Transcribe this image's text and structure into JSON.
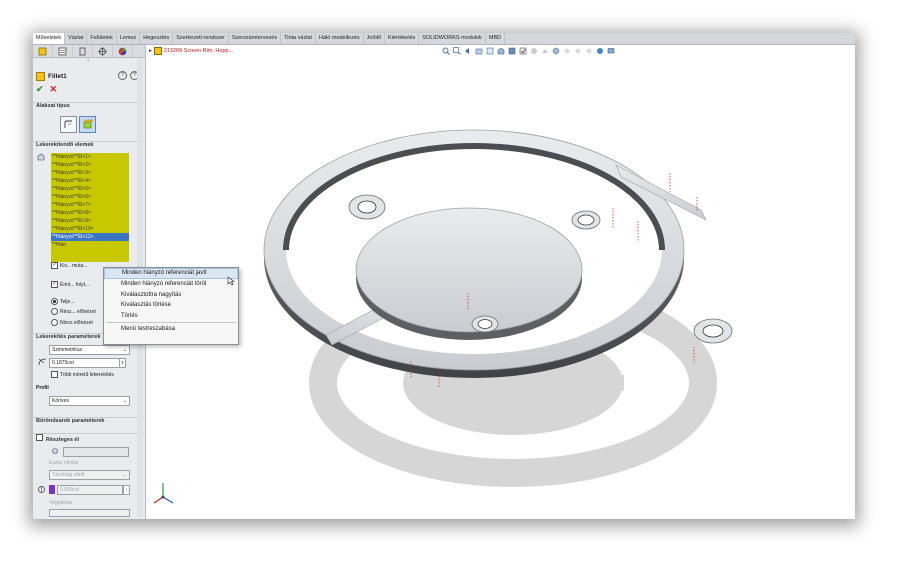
{
  "tabs": [
    "Műveletek",
    "Vázlat",
    "Felületek",
    "Lemez",
    "Hegesztés",
    "Szerkezeti rendszer",
    "Szerszámtervezés",
    "Tinta vázlat",
    "Háló modellezés",
    "Jelölő",
    "Kiértékelés",
    "SOLIDWORKS modulok",
    "MBD"
  ],
  "feature": {
    "title": "Fillet1"
  },
  "sections": {
    "fillet_type": "Alakzat típus",
    "items": "Lekerekítendő elemek",
    "params": "Lekerekítés paraméterek",
    "profile": "Profil",
    "setback": "Böröndsarok paraméterek",
    "partial": "Részleges él"
  },
  "missing_items": [
    "**Hiányzó**Él<1>",
    "**Hiányzó**Él<2>",
    "**Hiányzó**Él<3>",
    "**Hiányzó**Él<4>",
    "**Hiányzó**Él<5>",
    "**Hiányzó**Él<6>",
    "**Hiányzó**Él<7>",
    "**Hiányzó**Él<8>",
    "**Hiányzó**Él<9>",
    "**Hiányzó**Él<10>",
    "**Hiányzó**Él<11>",
    "**Hián"
  ],
  "options": {
    "show_callout": "Kiv... muta...",
    "tangent": "Érint... folyt...",
    "full_preview": "Telje...",
    "partial_preview": "Rész... előnézet",
    "no_preview": "Nincs előnézet"
  },
  "params": {
    "symmetric": "Szimmetrikus",
    "radius": "0.1875col",
    "multi_radius": "Több méretű lekerekítés",
    "profile_value": "Köríves",
    "offset_label": "Eszöz eltolás",
    "offset_sel": "Távolság eltolt",
    "offset_val": "0.000col",
    "end_label": "Végeltolás"
  },
  "context_menu": [
    "Minden hiányzó referenciát javít",
    "Minden hiányzó referenciát töröl",
    "Kiválasztottra nagyítás",
    "Kiválasztás törlése",
    "Törlés",
    "Menü testreszabása"
  ],
  "breadcrumb": "313269 Screen Rim, Hopp...",
  "colors": {
    "accent": "#3b76c4",
    "missing": "#c8c800",
    "error": "#c01818",
    "ok": "#2fa03a"
  }
}
